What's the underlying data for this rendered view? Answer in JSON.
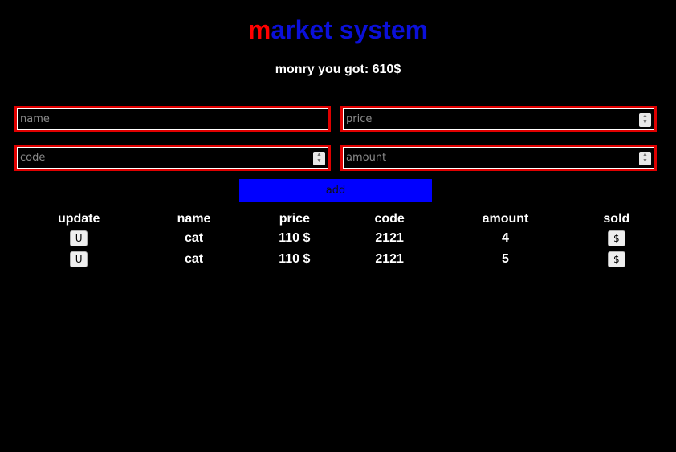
{
  "header": {
    "title_first": "m",
    "title_rest": "arket system",
    "money_label": "monry you got: 610$"
  },
  "form": {
    "name_placeholder": "name",
    "price_placeholder": "price",
    "code_placeholder": "code",
    "amount_placeholder": "amount",
    "add_label": "add"
  },
  "table": {
    "headers": [
      "update",
      "name",
      "price",
      "code",
      "amount",
      "sold"
    ],
    "rows": [
      {
        "update_label": "U",
        "name": "cat",
        "price": "110 $",
        "code": "2121",
        "amount": "4",
        "sold_label": "$"
      },
      {
        "update_label": "U",
        "name": "cat",
        "price": "110 $",
        "code": "2121",
        "amount": "5",
        "sold_label": "$"
      }
    ]
  },
  "colors": {
    "background": "#000000",
    "title_accent": "#ff0000",
    "title_main": "#0b10d9",
    "field_border": "#e00000",
    "add_button": "#0000ff"
  }
}
